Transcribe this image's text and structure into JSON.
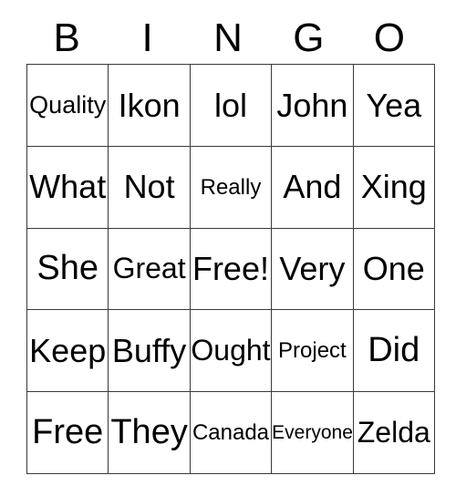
{
  "card": {
    "headers": [
      "B",
      "I",
      "N",
      "G",
      "O"
    ],
    "rows": [
      [
        {
          "text": "Quality",
          "size": "fs-sm"
        },
        {
          "text": "Ikon",
          "size": "fs-lg"
        },
        {
          "text": "lol",
          "size": "fs-lg"
        },
        {
          "text": "John",
          "size": "fs-lg"
        },
        {
          "text": "Yea",
          "size": "fs-lg"
        }
      ],
      [
        {
          "text": "What",
          "size": "fs-lg"
        },
        {
          "text": "Not",
          "size": "fs-lg"
        },
        {
          "text": "Really",
          "size": "fs-xs"
        },
        {
          "text": "And",
          "size": "fs-lg"
        },
        {
          "text": "Xing",
          "size": "fs-lg"
        }
      ],
      [
        {
          "text": "She",
          "size": "fs-xl"
        },
        {
          "text": "Great",
          "size": "fs-md"
        },
        {
          "text": "Free!",
          "size": "fs-lg"
        },
        {
          "text": "Very",
          "size": "fs-lg"
        },
        {
          "text": "One",
          "size": "fs-lg"
        }
      ],
      [
        {
          "text": "Keep",
          "size": "fs-lg"
        },
        {
          "text": "Buffy",
          "size": "fs-lg"
        },
        {
          "text": "Ought",
          "size": "fs-md"
        },
        {
          "text": "Project",
          "size": "fs-xs"
        },
        {
          "text": "Did",
          "size": "fs-xl"
        }
      ],
      [
        {
          "text": "Free",
          "size": "fs-xl"
        },
        {
          "text": "They",
          "size": "fs-xl"
        },
        {
          "text": "Canada",
          "size": "fs-xs"
        },
        {
          "text": "Everyone",
          "size": "fs-xxs"
        },
        {
          "text": "Zelda",
          "size": "fs-md"
        }
      ]
    ]
  },
  "colors": {
    "background": "#ffffff",
    "text": "#000000",
    "grid_line": "#3a3a3a"
  }
}
